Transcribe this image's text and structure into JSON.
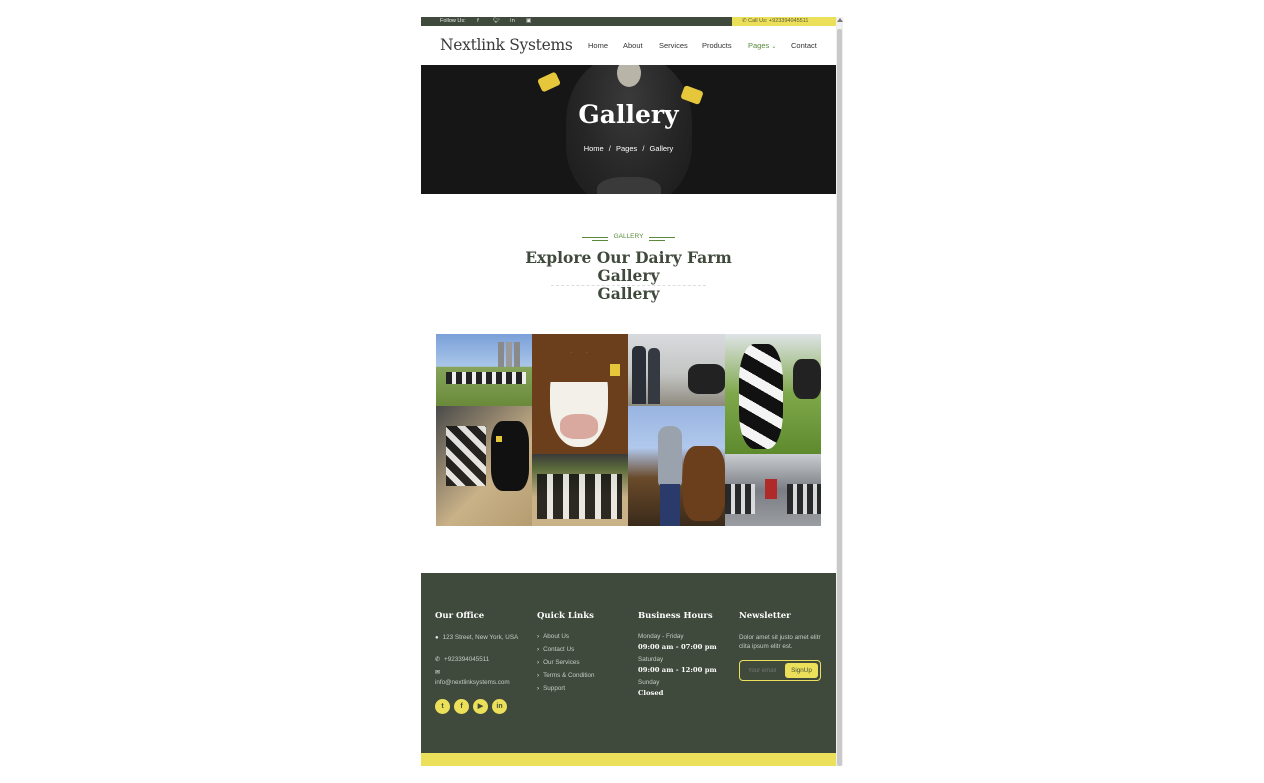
{
  "topbar": {
    "follow_label": "Follow Us:",
    "call_label": "Call Us: +923394045511",
    "social_icons": [
      "facebook-icon",
      "twitter-icon",
      "linkedin-icon",
      "instagram-icon"
    ]
  },
  "nav": {
    "brand": "Nextlink Systems",
    "items": [
      {
        "label": "Home"
      },
      {
        "label": "About"
      },
      {
        "label": "Services"
      },
      {
        "label": "Products"
      },
      {
        "label": "Pages"
      },
      {
        "label": "Contact"
      }
    ],
    "active_item": "Pages"
  },
  "hero": {
    "title": "Gallery",
    "breadcrumb": [
      "Home",
      "Pages",
      "Gallery"
    ],
    "separator": "/"
  },
  "gallery_section": {
    "tag": "GALLERY",
    "heading_line1": "Explore Our Dairy Farm",
    "heading_line2": "Gallery",
    "heading_line3": "Gallery"
  },
  "footer": {
    "office": {
      "title": "Our Office",
      "address": "123 Street, New York, USA",
      "phone": "+923394045511",
      "email": "info@nextlinksystems.com"
    },
    "quick_links": {
      "title": "Quick Links",
      "links": [
        "About Us",
        "Contact Us",
        "Our Services",
        "Terms & Condition",
        "Support"
      ]
    },
    "hours": {
      "title": "Business Hours",
      "rows": [
        {
          "day": "Monday - Friday",
          "time": "09:00 am - 07:00 pm"
        },
        {
          "day": "Saturday",
          "time": "09:00 am - 12:00 pm"
        },
        {
          "day": "Sunday",
          "time": "Closed"
        }
      ]
    },
    "newsletter": {
      "title": "Newsletter",
      "text": "Dolor amet sit justo amet elitr clita ipsum elitr est.",
      "placeholder": "Your email",
      "button": "SignUp"
    },
    "social_circles": [
      "twitter-icon",
      "facebook-icon",
      "youtube-icon",
      "linkedin-icon"
    ]
  },
  "colors": {
    "primary_dark": "#3f4a3c",
    "accent_yellow": "#ece05a",
    "accent_green": "#5a8a3a"
  }
}
